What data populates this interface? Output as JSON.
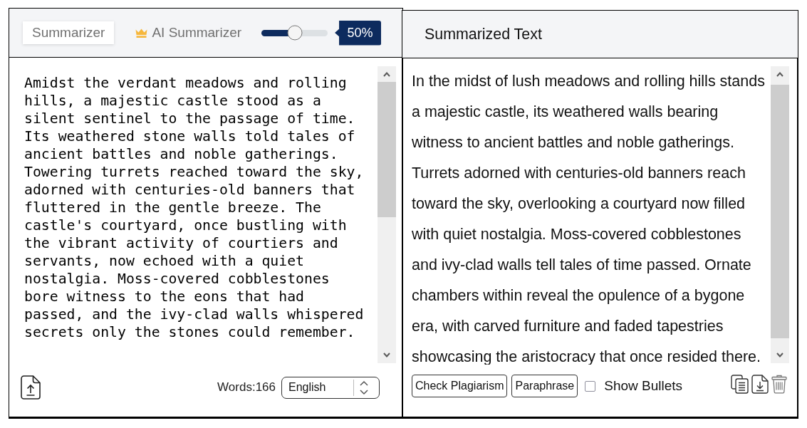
{
  "input_panel": {
    "tabs": [
      {
        "label": "Summarizer",
        "selected": true,
        "premium": false
      },
      {
        "label": "AI Summarizer",
        "selected": false,
        "premium": true
      }
    ],
    "slider": {
      "level": 0.5,
      "reading": "50%"
    },
    "text": "Amidst the verdant meadows and rolling hills, a majestic castle stood as a silent sentinel to the passage of time. Its weathered stone walls told tales of ancient battles and noble gatherings. Towering turrets reached toward the sky, adorned with centuries-old banners that fluttered in the gentle breeze. The castle's courtyard, once bustling with the vibrant activity of courtiers and servants, now echoed with a quiet nostalgia. Moss-covered cobblestones bore witness to the eons that had passed, and the ivy-clad walls whispered secrets only the stones could remember.",
    "word_count": "Words:166",
    "language": "English"
  },
  "output_panel": {
    "title": "Summarized Text",
    "text": "In the midst of lush meadows and rolling hills stands a majestic castle, its weathered walls bearing witness to ancient battles and noble gatherings. Turrets adorned with centuries-old banners reach toward the sky, overlooking a courtyard now filled with quiet nostalgia. Moss-covered cobblestones and ivy-clad walls tell tales of time passed. Ornate chambers within reveal the opulence of a bygone era, with carved furniture and faded tapestries showcasing the aristocracy that once resided there.",
    "buttons": [
      "Check Plagiarism",
      "Paraphrase"
    ],
    "show_bullets": {
      "label": "Show Bullets",
      "checked": false
    }
  }
}
